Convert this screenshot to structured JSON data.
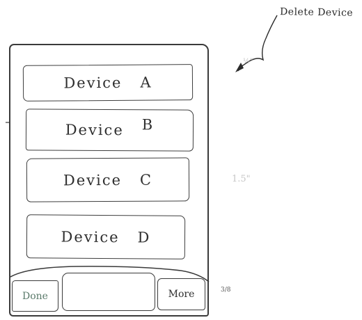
{
  "devices": [
    {
      "name": "Device",
      "letter": "A"
    },
    {
      "name": "Device",
      "letter": "B"
    },
    {
      "name": "Device",
      "letter": "C"
    },
    {
      "name": "Device",
      "letter": "D"
    }
  ],
  "toolbar": {
    "done_label": "Done",
    "middle_label": "",
    "more_label": "More"
  },
  "annotations": {
    "delete_device": "Delete Device",
    "width_note": "½\"",
    "height_note": "1.5\"",
    "fraction_note": "3/8"
  },
  "colors": {
    "ink": "#2b2b2b",
    "faint_pencil": "#c6c6c6",
    "done_tint": "#5a7a6a"
  }
}
